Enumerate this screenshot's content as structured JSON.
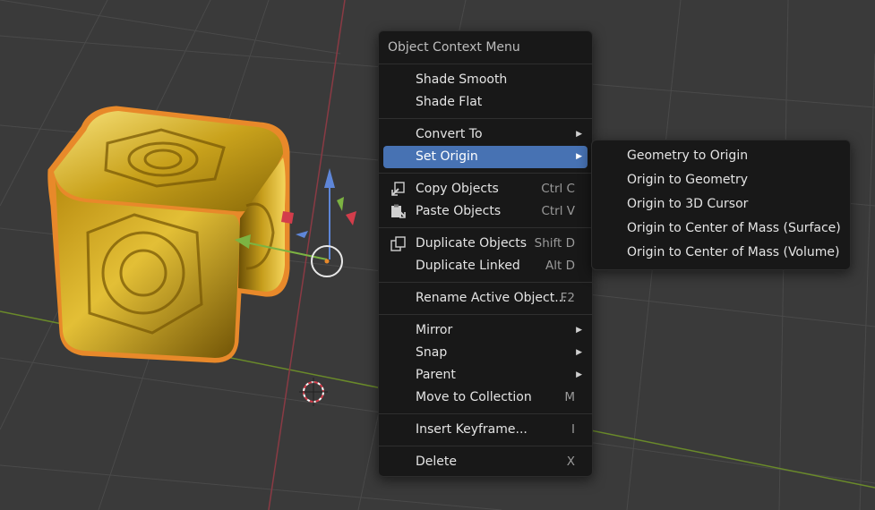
{
  "context_menu": {
    "title": "Object Context Menu",
    "groups": [
      [
        {
          "label": "Shade Smooth"
        },
        {
          "label": "Shade Flat"
        }
      ],
      [
        {
          "label": "Convert To",
          "submenu": true
        },
        {
          "label": "Set Origin",
          "submenu": true,
          "active": true
        }
      ],
      [
        {
          "label": "Copy Objects",
          "shortcut": "Ctrl C",
          "icon": "copy-icon"
        },
        {
          "label": "Paste Objects",
          "shortcut": "Ctrl V",
          "icon": "paste-icon"
        }
      ],
      [
        {
          "label": "Duplicate Objects",
          "shortcut": "Shift D",
          "icon": "duplicate-icon"
        },
        {
          "label": "Duplicate Linked",
          "shortcut": "Alt D"
        }
      ],
      [
        {
          "label": "Rename Active Object...",
          "shortcut": "F2"
        }
      ],
      [
        {
          "label": "Mirror",
          "submenu": true
        },
        {
          "label": "Snap",
          "submenu": true
        },
        {
          "label": "Parent",
          "submenu": true
        },
        {
          "label": "Move to Collection",
          "shortcut": "M"
        }
      ],
      [
        {
          "label": "Insert Keyframe...",
          "shortcut": "I"
        }
      ],
      [
        {
          "label": "Delete",
          "shortcut": "X"
        }
      ]
    ]
  },
  "set_origin_submenu": {
    "items": [
      {
        "label": "Geometry to Origin"
      },
      {
        "label": "Origin to Geometry"
      },
      {
        "label": "Origin to 3D Cursor"
      },
      {
        "label": "Origin to Center of Mass (Surface)"
      },
      {
        "label": "Origin to Center of Mass (Volume)"
      }
    ]
  },
  "viewport": {
    "background": "#3a3a3a",
    "grid_color": "#4a4a4a",
    "x_axis_color": "#8a3a44",
    "y_axis_color": "#6a8a2a",
    "object": "gold cube",
    "selection_outline_color": "#e8892a",
    "accent_color": "#4772b3"
  }
}
